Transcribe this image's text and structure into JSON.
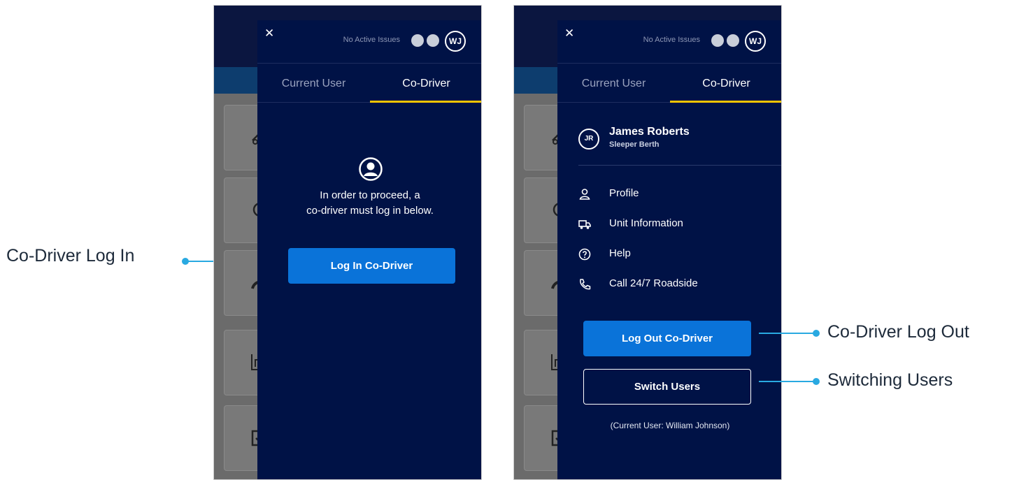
{
  "callouts": {
    "login": "Co-Driver Log In",
    "logout": "Co-Driver Log Out",
    "switching": "Switching Users"
  },
  "header": {
    "status": "No Active Issues",
    "avatar_initials": "WJ"
  },
  "tabs": {
    "current": "Current User",
    "codriver": "Co-Driver"
  },
  "left_screen": {
    "message_line1": "In order to proceed, a",
    "message_line2": "co-driver must log in below.",
    "login_button": "Log In Co-Driver"
  },
  "right_screen": {
    "user": {
      "initials": "JR",
      "name": "James Roberts",
      "status": "Sleeper Berth"
    },
    "menu": [
      {
        "label": "Profile",
        "icon": "person-icon"
      },
      {
        "label": "Unit Information",
        "icon": "truck-icon"
      },
      {
        "label": "Help",
        "icon": "help-icon"
      },
      {
        "label": "Call 24/7 Roadside",
        "icon": "phone-icon"
      }
    ],
    "logout_button": "Log Out Co-Driver",
    "switch_button": "Switch Users",
    "current_user_note": "(Current User: William Johnson)"
  },
  "colors": {
    "drawer_bg": "#001246",
    "primary_button": "#0a73d9",
    "active_tab_underline": "#f5c400",
    "callout_accent": "#29a9e1"
  }
}
